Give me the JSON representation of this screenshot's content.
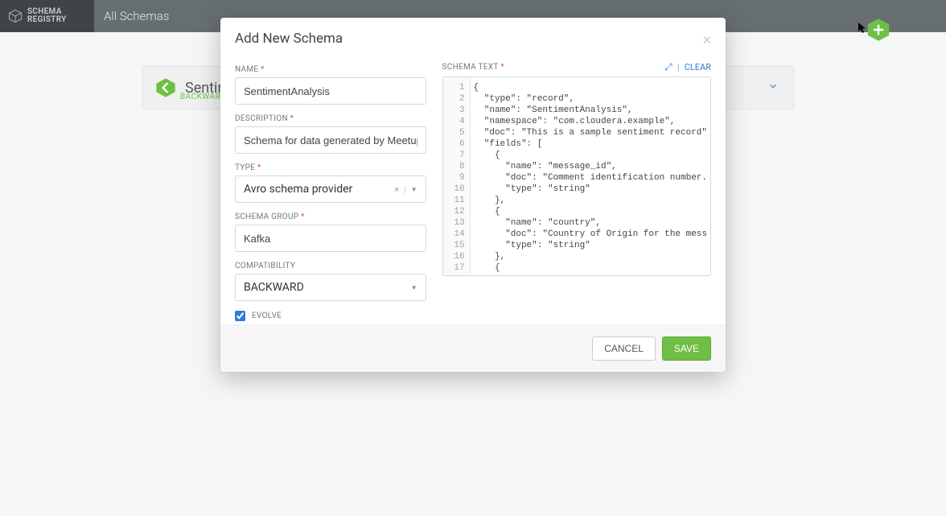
{
  "header": {
    "logo_line1": "SCHEMA",
    "logo_line2": "REGISTRY",
    "title": "All Schemas"
  },
  "background_card": {
    "name": "SentimentA",
    "compat": "BACKWARD"
  },
  "modal": {
    "title": "Add New Schema",
    "labels": {
      "name": "NAME",
      "description": "DESCRIPTION",
      "type": "TYPE",
      "schema_group": "SCHEMA GROUP",
      "compatibility": "COMPATIBILITY",
      "evolve": "EVOLVE",
      "schema_text": "SCHEMA TEXT",
      "clear": "CLEAR"
    },
    "values": {
      "name": "SentimentAnalysis",
      "description": "Schema for data generated by Meetup",
      "type": "Avro schema provider",
      "schema_group": "Kafka",
      "compatibility": "BACKWARD",
      "evolve": true
    },
    "buttons": {
      "cancel": "CANCEL",
      "save": "SAVE"
    },
    "close": "×",
    "required_star": "*",
    "type_clear": "×",
    "expand_icon": "⤢",
    "divider": "|"
  },
  "code": {
    "line_count": 17,
    "lines": [
      "{",
      "  \"type\": \"record\",",
      "  \"name\": \"SentimentAnalysis\",",
      "  \"namespace\": \"com.cloudera.example\",",
      "  \"doc\": \"This is a sample sentiment record\"",
      "  \"fields\": [",
      "    {",
      "      \"name\": \"message_id\",",
      "      \"doc\": \"Comment identification number.",
      "      \"type\": \"string\"",
      "    },",
      "    {",
      "      \"name\": \"country\",",
      "      \"doc\": \"Country of Origin for the mess",
      "      \"type\": \"string\"",
      "    },",
      "    {"
    ]
  }
}
